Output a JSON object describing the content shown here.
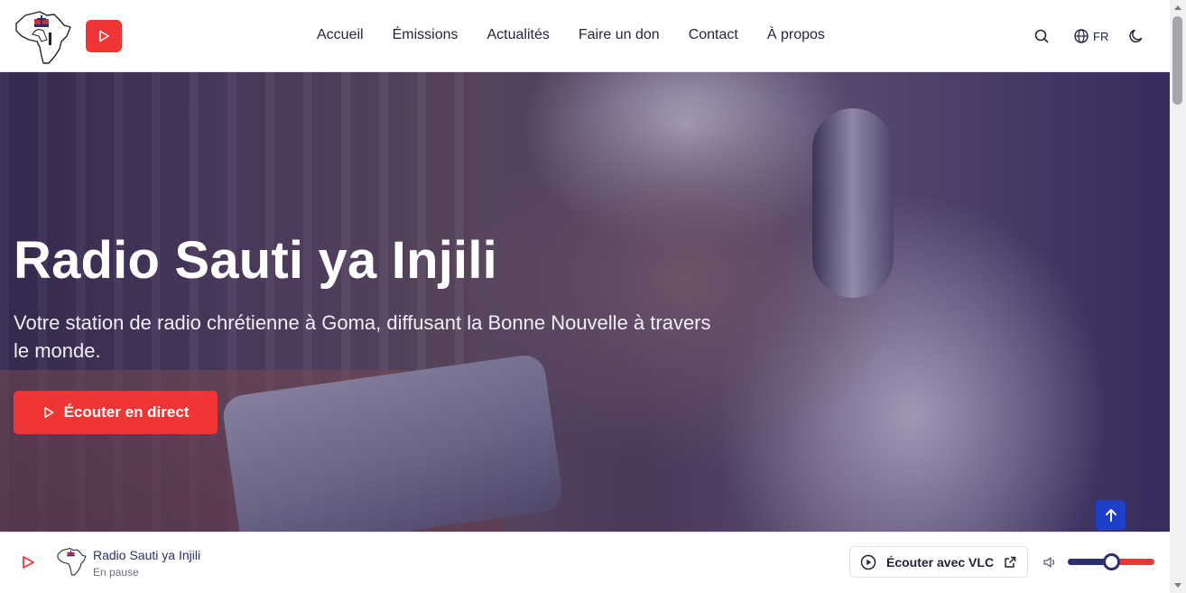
{
  "brand": {
    "logo_icon": "africa-map-logo",
    "youtube_icon": "play-icon",
    "accent": "#ef3535",
    "navy": "#2b2f6b"
  },
  "nav": {
    "items": [
      {
        "label": "Accueil"
      },
      {
        "label": "Émissions"
      },
      {
        "label": "Actualités"
      },
      {
        "label": "Faire un don"
      },
      {
        "label": "Contact"
      },
      {
        "label": "À propos"
      }
    ],
    "language": "FR",
    "search_icon": "search-icon",
    "globe_icon": "globe-icon",
    "theme_icon": "moon-icon"
  },
  "hero": {
    "title": "Radio Sauti ya Injili",
    "subtitle": "Votre station de radio chrétienne à Goma, diffusant la Bonne Nouvelle à travers le monde.",
    "cta_label": "Écouter en direct"
  },
  "player": {
    "station_name": "Radio Sauti ya Injili",
    "status": "En pause",
    "vlc_label": "Écouter avec VLC",
    "volume_level": 0.5
  }
}
